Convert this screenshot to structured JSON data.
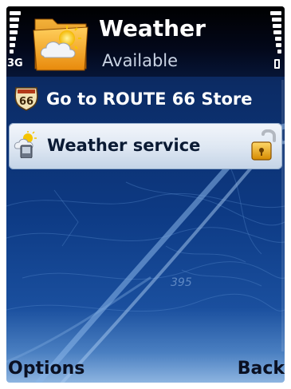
{
  "header": {
    "network_label": "3G",
    "title": "Weather",
    "status": "Available",
    "app_icon": "folder-weather-icon"
  },
  "list": {
    "items": [
      {
        "label": "Go to ROUTE 66 Store",
        "icon": "route66-shield-icon",
        "selected": false
      },
      {
        "label": "Weather service",
        "icon": "weather-service-icon",
        "selected": true,
        "trailing_icon": "unlocked-padlock-icon"
      }
    ]
  },
  "background": {
    "map_label": "395"
  },
  "softkeys": {
    "left": "Options",
    "right": "Back"
  },
  "colors": {
    "header_bg": "#000000",
    "body_bg": "#0d3a84",
    "selection_bg": "#dfe8f3",
    "text_light": "#ffffff",
    "text_dark": "#0a1a33",
    "folder_orange": "#f7a11a"
  }
}
